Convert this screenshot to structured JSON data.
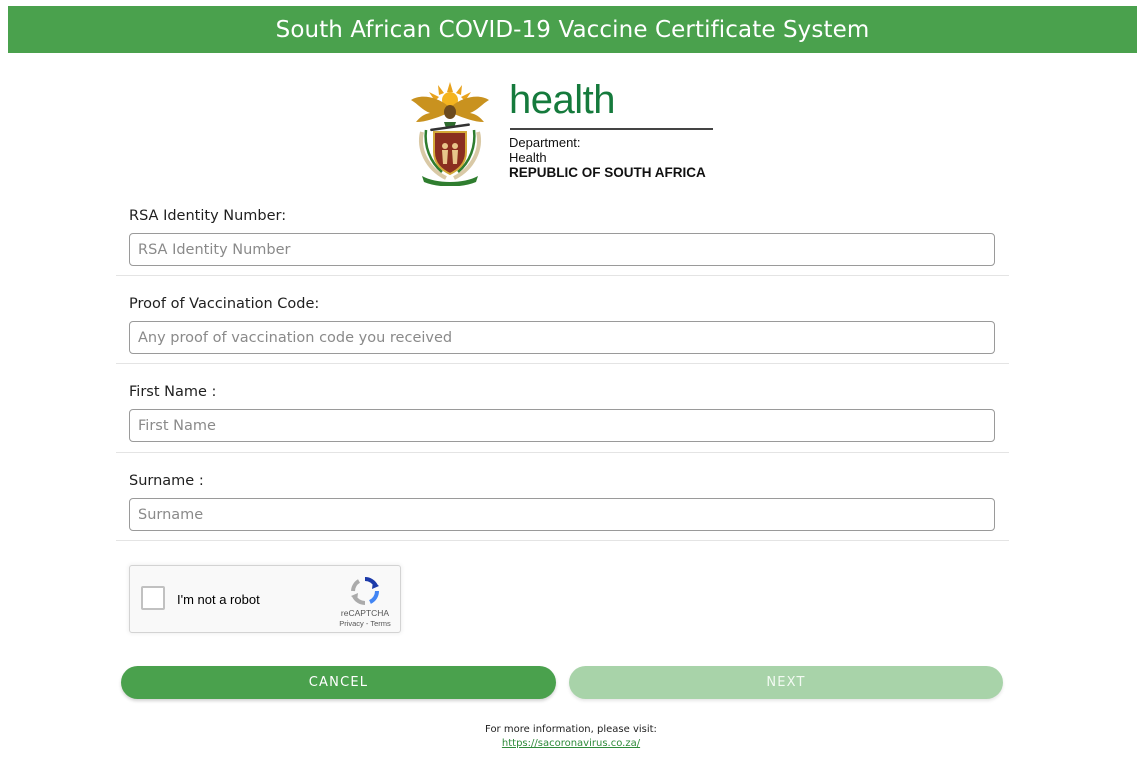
{
  "header": {
    "title": "South African COVID-19 Vaccine Certificate System"
  },
  "logo": {
    "icon": "coat-of-arms",
    "word": "health",
    "line1": "Department:",
    "line2": "Health",
    "line3": "REPUBLIC OF SOUTH AFRICA",
    "color": "#157a3c"
  },
  "form": {
    "id_number": {
      "label": "RSA Identity Number:",
      "placeholder": "RSA Identity Number",
      "value": ""
    },
    "proof_code": {
      "label": "Proof of Vaccination Code:",
      "placeholder": "Any proof of vaccination code you received",
      "value": ""
    },
    "first_name": {
      "label": "First Name :",
      "placeholder": "First Name",
      "value": ""
    },
    "surname": {
      "label": "Surname :",
      "placeholder": "Surname",
      "value": ""
    }
  },
  "captcha": {
    "label": "I'm not a robot",
    "brand": "reCAPTCHA",
    "links": "Privacy - Terms",
    "checked": false
  },
  "buttons": {
    "cancel": "CANCEL",
    "next": "NEXT"
  },
  "footer": {
    "text": "For more information, please visit:",
    "link": "https://sacoronavirus.co.za/"
  },
  "colors": {
    "primary": "#4aa14d",
    "primary_disabled": "#a8d3a9",
    "link": "#2e8b3a"
  }
}
